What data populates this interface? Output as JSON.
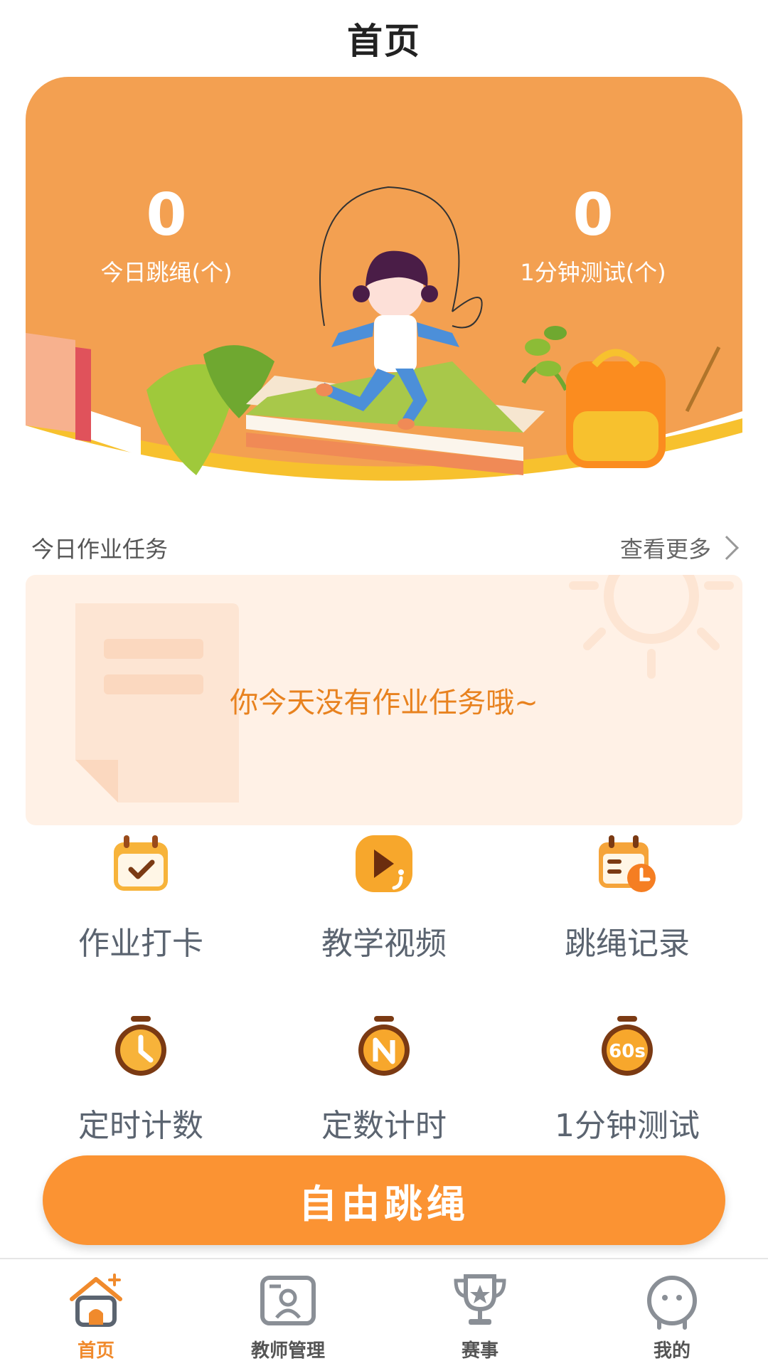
{
  "header": {
    "title": "首页"
  },
  "hero": {
    "left_stat": {
      "value": "0",
      "label": "今日跳绳(个)"
    },
    "right_stat": {
      "value": "0",
      "label": "1分钟测试(个)"
    }
  },
  "tasks": {
    "heading": "今日作业任务",
    "more_label": "查看更多",
    "empty_text": "你今天没有作业任务哦~"
  },
  "features": [
    {
      "label": "作业打卡",
      "icon": "calendar-check-icon"
    },
    {
      "label": "教学视频",
      "icon": "video-play-icon"
    },
    {
      "label": "跳绳记录",
      "icon": "calendar-clock-icon"
    },
    {
      "label": "定时计数",
      "icon": "stopwatch-icon"
    },
    {
      "label": "定数计时",
      "icon": "stopwatch-n-icon"
    },
    {
      "label": "1分钟测试",
      "icon": "stopwatch-60s-icon"
    }
  ],
  "primary_action": {
    "label": "自由跳绳"
  },
  "tabbar": {
    "items": [
      {
        "label": "首页",
        "icon": "home-icon",
        "active": true
      },
      {
        "label": "教师管理",
        "icon": "teacher-icon",
        "active": false
      },
      {
        "label": "赛事",
        "icon": "trophy-icon",
        "active": false
      },
      {
        "label": "我的",
        "icon": "profile-icon",
        "active": false
      }
    ]
  },
  "colors": {
    "accent": "#fb9333",
    "hero_bg": "#f3a051",
    "task_bg": "#fff1e6",
    "empty_text": "#e8821f",
    "tab_active": "#f08a2c"
  }
}
